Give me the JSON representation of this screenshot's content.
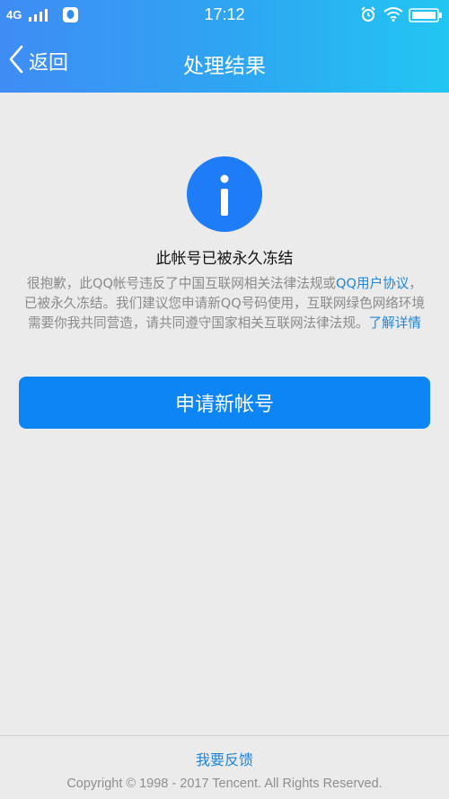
{
  "status_bar": {
    "network": "4G",
    "time": "17:12",
    "icons": [
      "signal-icon",
      "app-notification-icon",
      "alarm-icon",
      "wifi-icon",
      "battery-icon"
    ]
  },
  "nav": {
    "back_label": "返回",
    "title": "处理结果",
    "back_icon": "chevron-left-icon"
  },
  "result": {
    "icon": "info-icon",
    "title": "此帐号已被永久冻结",
    "desc_part1": "很抱歉，此QQ帐号违反了中国互联网相关法律法规或",
    "desc_link_agreement": "QQ用户协议",
    "desc_part2": "，已被永久冻结。我们建议您申请新QQ号码使用，互联网绿色网络环境需要你我共同营造，请共同遵守国家相关互联网法律法规。",
    "desc_link_details": "了解详情"
  },
  "actions": {
    "apply_new_account": "申请新帐号"
  },
  "footer": {
    "feedback": "我要反馈",
    "copyright": "Copyright © 1998 - 2017 Tencent. All Rights Reserved."
  },
  "colors": {
    "header_gradient_start": "#3f8cf5",
    "header_gradient_end": "#22c6f2",
    "primary_button": "#0d85f4",
    "link": "#1d86d8",
    "background": "#ebebeb"
  }
}
